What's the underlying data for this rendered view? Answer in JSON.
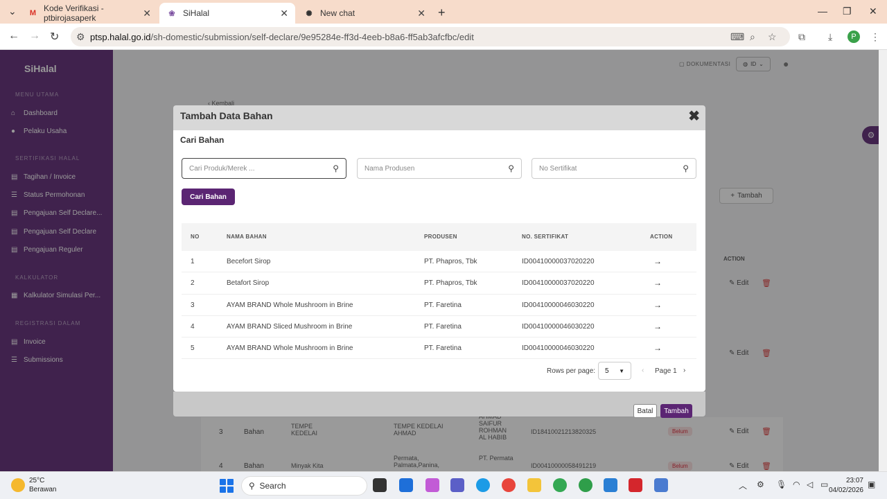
{
  "browser": {
    "tabs": [
      {
        "title": "Kode Verifikasi - ptbirojasaperk",
        "icon": "gmail-icon"
      },
      {
        "title": "SiHalal",
        "icon": "sihalal-icon",
        "active": true
      },
      {
        "title": "New chat",
        "icon": "chatgpt-icon"
      }
    ],
    "url_host": "ptsp.halal.go.id",
    "url_path": "/sh-domestic/submission/self-declare/9e95284e-ff3d-4eeb-b8a6-ff5ab3afcfbc/edit",
    "profile_initial": "P"
  },
  "app": {
    "brand": "SiHalal",
    "doc_link": "DOKUMENTASI",
    "lang": "ID",
    "sidebar": {
      "sections": [
        "MENU UTAMA",
        "SERTIFIKASI HALAL",
        "KALKULATOR",
        "REGISTRASI DALAM"
      ],
      "items": [
        {
          "label": "Dashboard",
          "icon": "home-icon"
        },
        {
          "label": "Pelaku Usaha",
          "icon": "user-icon"
        },
        {
          "label": "Tagihan / Invoice",
          "icon": "invoice-icon"
        },
        {
          "label": "Status Permohonan",
          "icon": "list-icon"
        },
        {
          "label": "Pengajuan Self Declare...",
          "icon": "doc-icon"
        },
        {
          "label": "Pengajuan Self Declare",
          "icon": "doc-icon"
        },
        {
          "label": "Pengajuan Reguler",
          "icon": "doc-icon"
        },
        {
          "label": "Kalkulator Simulasi Per...",
          "icon": "calculator-icon"
        },
        {
          "label": "Invoice",
          "icon": "invoice-icon"
        },
        {
          "label": "Submissions",
          "icon": "list-icon"
        }
      ]
    },
    "background": {
      "back_link": "Kembali",
      "tambah_button": "Tambah",
      "action_header": "ACTION",
      "edit_label": "Edit",
      "rows": [
        {
          "no": "3",
          "type": "Bahan",
          "name": "TEMPE KEDELAI",
          "producer": "TEMPE KEDELAI AHMAD",
          "extra": "AHMAD SAIFUR ROHMAN AL HABIB",
          "cert": "ID18410021213820325",
          "status": "Belum"
        },
        {
          "no": "4",
          "type": "Bahan",
          "name": "Minyak Kita",
          "producer": "Permata, Palmata,Panina,",
          "extra": "PT. Permata",
          "cert": "ID00410000058491219",
          "status": "Belum"
        }
      ]
    }
  },
  "modal": {
    "title": "Tambah Data Bahan",
    "section_title": "Cari Bahan",
    "search": {
      "product_placeholder": "Cari Produk/Merek ...",
      "producer_placeholder": "Nama Produsen",
      "cert_placeholder": "No Sertifikat"
    },
    "search_button": "Cari Bahan",
    "table": {
      "headers": [
        "NO",
        "NAMA BAHAN",
        "PRODUSEN",
        "NO. SERTIFIKAT",
        "ACTION"
      ],
      "rows": [
        {
          "no": "1",
          "name": "Becefort Sirop",
          "producer": "PT. Phapros, Tbk",
          "cert": "ID00410000037020220"
        },
        {
          "no": "2",
          "name": "Betafort Sirop",
          "producer": "PT. Phapros, Tbk",
          "cert": "ID00410000037020220"
        },
        {
          "no": "3",
          "name": "AYAM BRAND Whole Mushroom in Brine",
          "producer": "PT. Faretina",
          "cert": "ID00410000046030220"
        },
        {
          "no": "4",
          "name": "AYAM BRAND Sliced Mushroom in Brine",
          "producer": "PT. Faretina",
          "cert": "ID00410000046030220"
        },
        {
          "no": "5",
          "name": "AYAM BRAND Whole Mushroom in Brine",
          "producer": "PT. Faretina",
          "cert": "ID00410000046030220"
        }
      ]
    },
    "pagination": {
      "rows_per_page_label": "Rows per page:",
      "rows_per_page": "5",
      "page_label": "Page 1"
    },
    "footer": {
      "cancel": "Batal",
      "submit": "Tambah"
    }
  },
  "taskbar": {
    "weather_temp": "25°C",
    "weather_desc": "Berawan",
    "search_label": "Search",
    "time": "23:07",
    "date": "04/02/2026"
  },
  "colors": {
    "brand_purple": "#5b2573",
    "tab_bar": "#f7dccb"
  }
}
